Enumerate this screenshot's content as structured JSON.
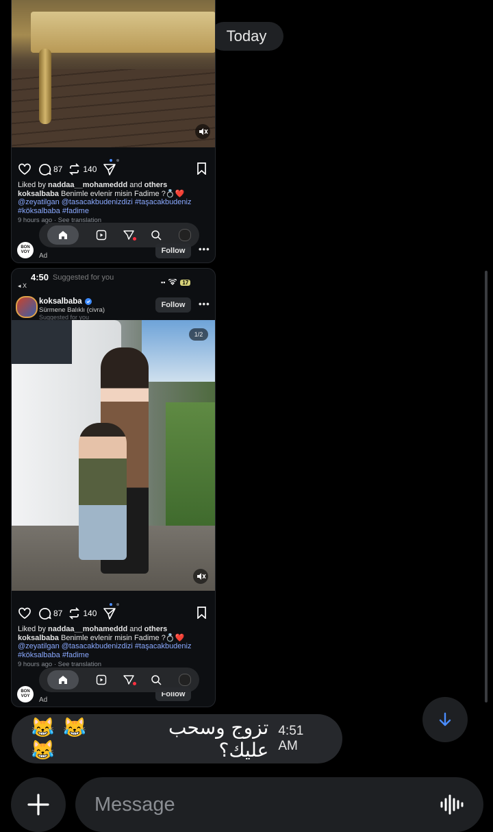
{
  "date_chip": "Today",
  "card1": {
    "actions": {
      "comments": "87",
      "reposts": "140"
    },
    "liked_by_prefix": "Liked by ",
    "liked_by_user": "naddaa__mohameddd",
    "liked_by_and": " and ",
    "liked_by_others": "others",
    "caption_user": "koksalbaba",
    "caption_text": " Benimle evlenir misin Fadime ?💍❤️",
    "hashtags_line1": "@zeyatilgan @tasacakbudenizdizi #taşacakbudeniz",
    "hashtags_line2": "#köksalbaba #fadime",
    "time_text": "9 hours ago",
    "see_translation": "See translation",
    "ad_logo": "BON VOY",
    "ad_label": "Ad",
    "follow_label": "Follow"
  },
  "card2": {
    "status_time": "4:50",
    "status_back": "◂ X",
    "status_battery": "17",
    "overlay_text": "Suggested for you",
    "username": "koksalbaba",
    "location": "Sürmene Balıklı (civra)",
    "suggested": "Suggested for you",
    "follow_label": "Follow",
    "page_indicator": "1/2",
    "actions": {
      "comments": "87",
      "reposts": "140"
    },
    "liked_by_prefix": "Liked by ",
    "liked_by_user": "naddaa__mohameddd",
    "liked_by_and": " and ",
    "liked_by_others": "others",
    "caption_user": "koksalbaba",
    "caption_text": " Benimle evlenir misin Fadime ?💍❤️",
    "hashtags_line1": "@zeyatilgan @tasacakbudenizdizi #taşacakbudeniz",
    "hashtags_line2": "#köksalbaba #fadime",
    "time_text": "9 hours ago",
    "see_translation": "See translation",
    "ad_logo": "BON VOY",
    "ad_label": "Ad",
    "ad_follow_label": "Follow"
  },
  "message": {
    "emojis": "😹 😹 😹",
    "text": "تزوج وسحب عليك؟",
    "time": "4:51 AM"
  },
  "composer": {
    "placeholder": "Message"
  },
  "colors": {
    "background": "#000000",
    "bubble": "#26282c",
    "accent_blue": "#4a8cff",
    "link": "#8aa9ff"
  },
  "icons": [
    "heart-icon",
    "comment-icon",
    "repost-icon",
    "share-icon",
    "bookmark-icon",
    "home-icon",
    "reels-icon",
    "send-icon",
    "search-icon",
    "mute-icon",
    "verified-icon",
    "plus-icon",
    "voice-icon",
    "arrow-down-icon"
  ]
}
